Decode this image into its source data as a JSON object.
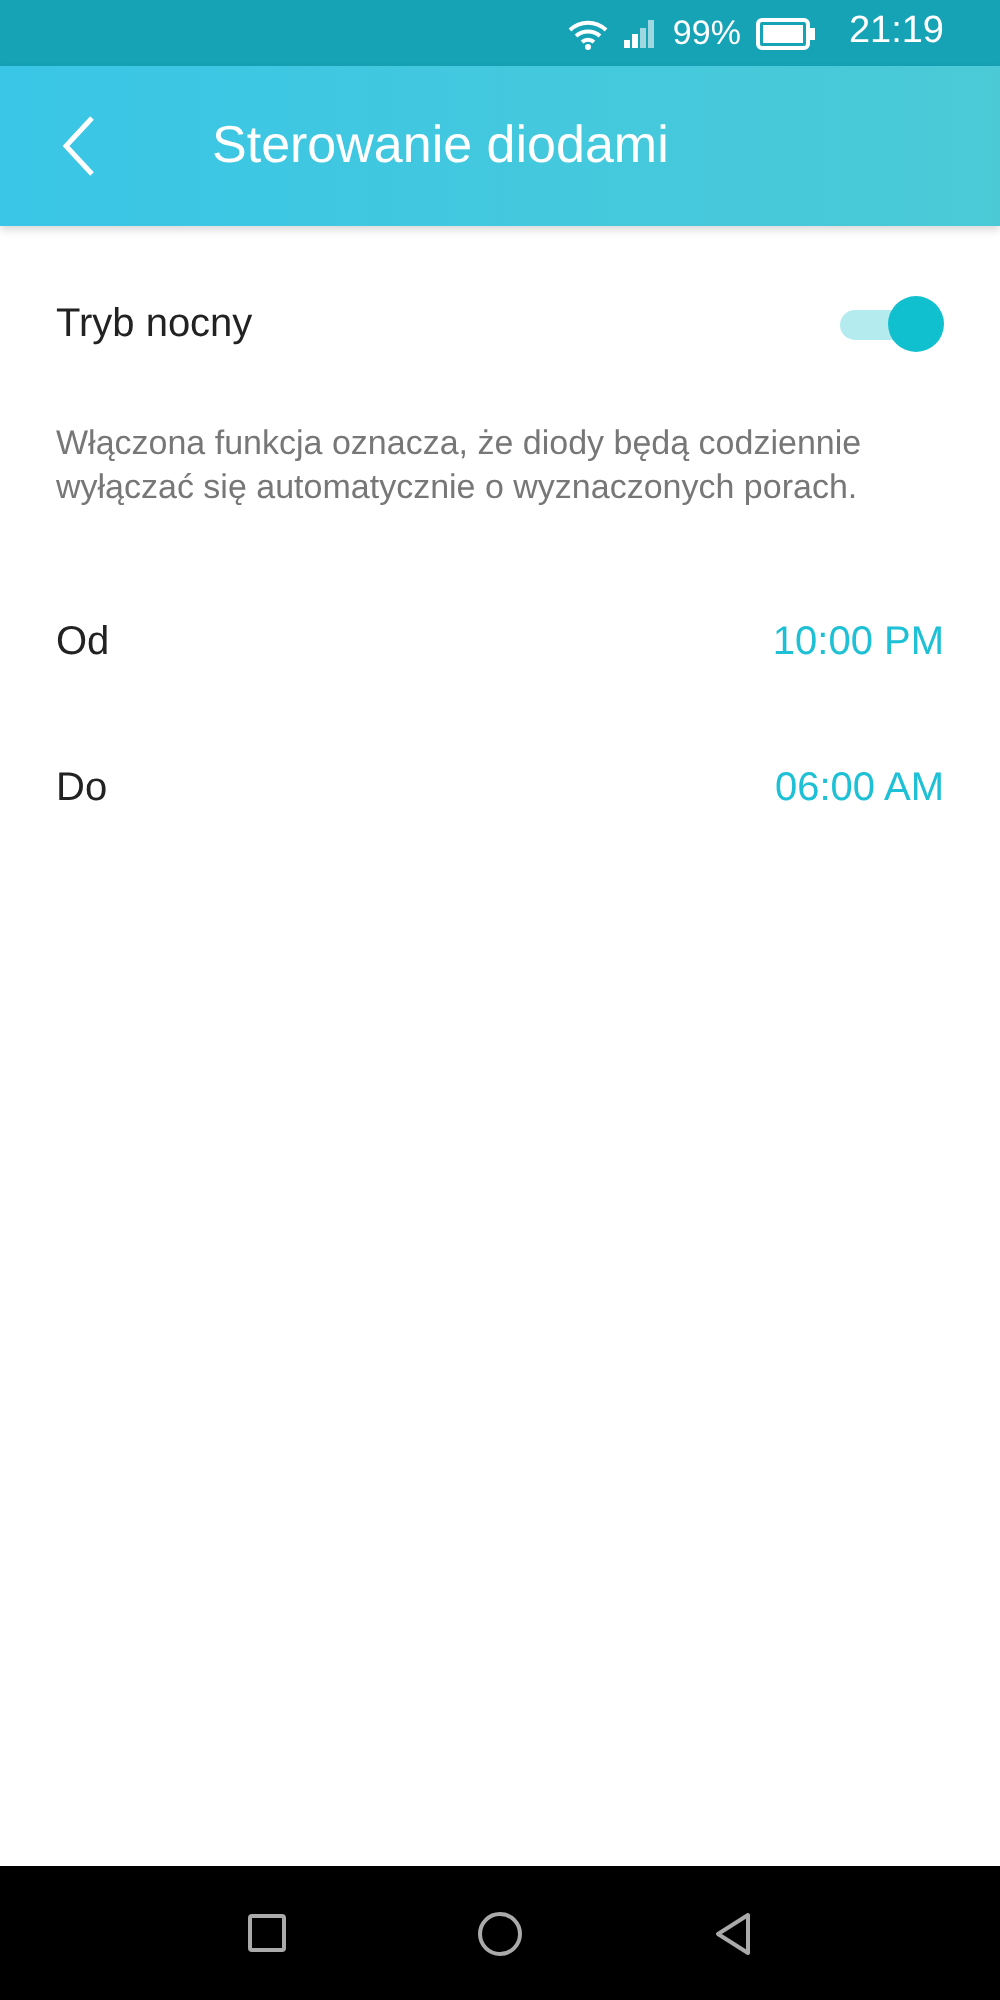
{
  "status_bar": {
    "battery": "99%",
    "time": "21:19"
  },
  "header": {
    "title": "Sterowanie diodami"
  },
  "night_mode": {
    "label": "Tryb nocny",
    "on": true
  },
  "description": "Włączona funkcja oznacza, że diody będą codziennie wyłączać się automatycznie o wyznaczonych porach.",
  "schedule": [
    {
      "label": "Od",
      "value": "10:00 PM"
    },
    {
      "label": "Do",
      "value": "06:00 AM"
    }
  ]
}
